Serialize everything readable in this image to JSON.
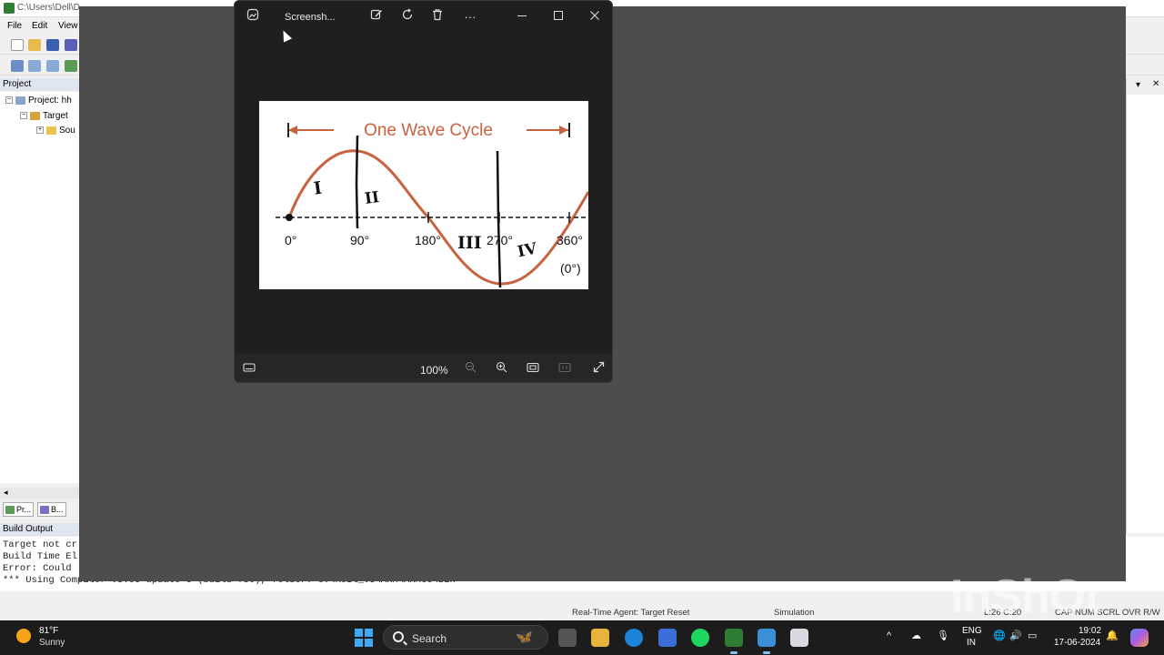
{
  "ide": {
    "title_path": "C:\\Users\\Dell\\D",
    "menu": [
      "File",
      "Edit",
      "View"
    ],
    "project_header": "Project",
    "tree": [
      "Project: hh",
      "Target",
      "Sou"
    ],
    "bottom_tabs": [
      "Pr...",
      "B..."
    ],
    "build_output_header": "Build Output",
    "build_lines": [
      "Target not cr",
      "Build Time El",
      "Error: Could",
      "*** Using Compiler  V5.06 update 6 (build 750), folder: C:\\Keil_v5\\ARM\\ARMCC\\Bin"
    ],
    "status": {
      "agent": "Real-Time Agent: Target Reset",
      "mode": "Simulation",
      "cursor": "L:26 C:20",
      "flags": "CAP  NUM  SCRL  OVR  R/W"
    }
  },
  "viewer": {
    "title": "Screensh...",
    "zoom": "100%",
    "image": {
      "heading": "One Wave Cycle",
      "angles": [
        "0°",
        "90°",
        "180°",
        "270°",
        "360°"
      ],
      "end_label": "(0°)",
      "quadrants": [
        "I",
        "II",
        "III",
        "IV"
      ],
      "wave_color": "#c8623f"
    }
  },
  "taskbar": {
    "weather_temp": "81°F",
    "weather_desc": "Sunny",
    "search_placeholder": "Search",
    "lang_line1": "ENG",
    "lang_line2": "IN",
    "time": "19:02",
    "date": "17-06-2024"
  },
  "watermark": "InShOt",
  "colors": {
    "accent": "#3fa7f5",
    "dim_overlay": "#4d4d4d",
    "viewer_bg": "#1f1f1f"
  }
}
